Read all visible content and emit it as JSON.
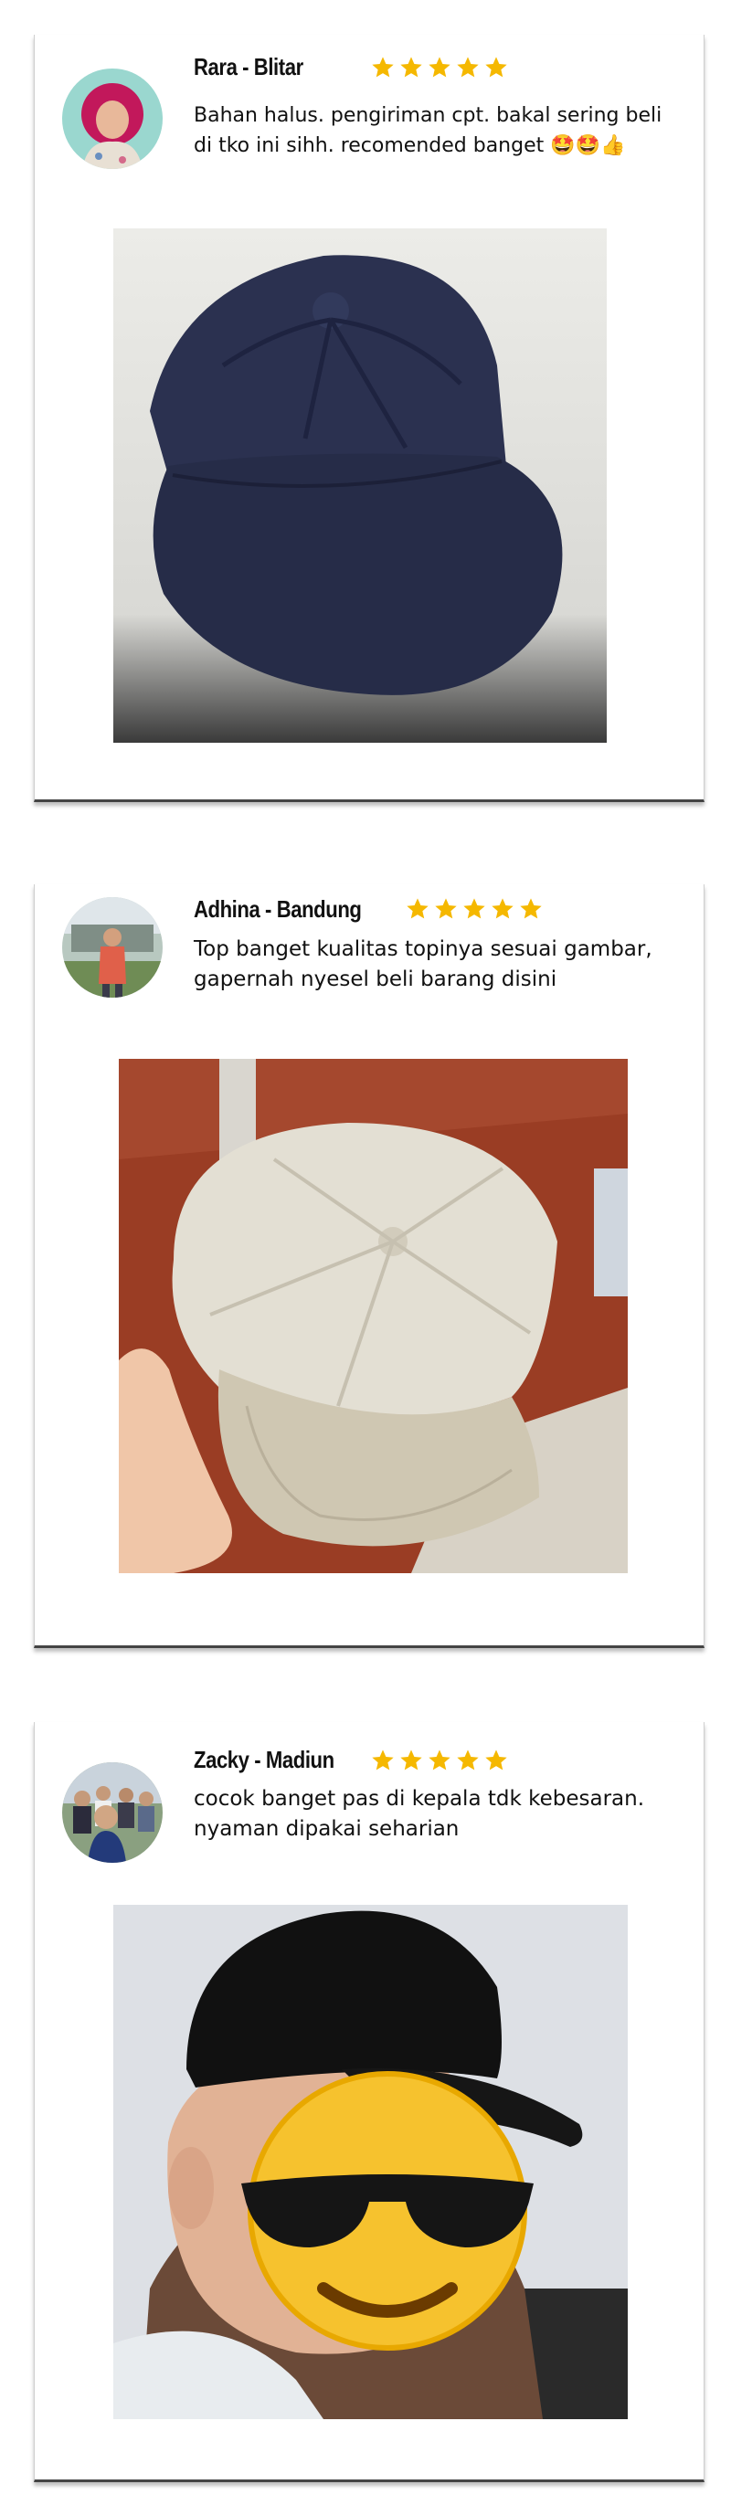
{
  "reviews": [
    {
      "name": "Rara - Blitar",
      "rating": 5,
      "review_lines": [
        "Bahan halus. pengiriman cpt. bakal sering beli",
        "di tko ini sihh. recomended banget 🤩🤩👍"
      ],
      "photo": "navy-newsboy-cap-photo",
      "avatar": "woman-hijab-avatar"
    },
    {
      "name": "Adhina - Bandung",
      "rating": 5,
      "review_lines": [
        "Top banget kualitas topinya sesuai gambar,",
        "gapernah nyesel beli barang disini"
      ],
      "photo": "beige-newsboy-cap-photo",
      "avatar": "woman-outdoor-avatar"
    },
    {
      "name": "Zacky - Madiun",
      "rating": 5,
      "review_lines": [
        "cocok banget pas di kepala tdk kebesaran.",
        "nyaman dipakai seharian"
      ],
      "photo": "black-cap-on-head-photo",
      "avatar": "group-photo-avatar"
    }
  ],
  "colors": {
    "star": "#F5B800",
    "card_border": "#444444"
  }
}
